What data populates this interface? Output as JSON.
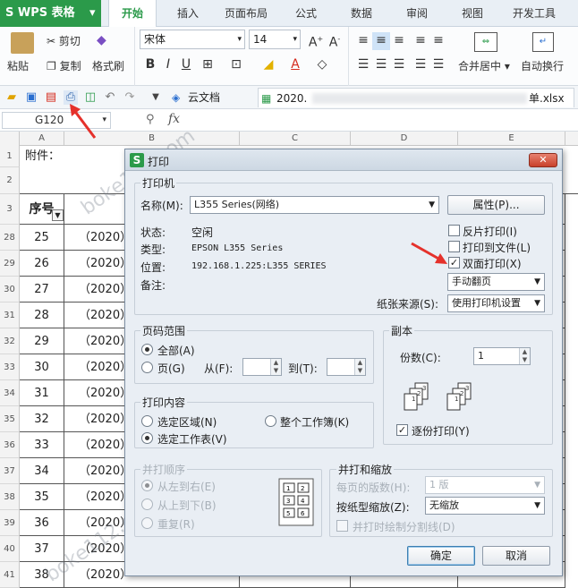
{
  "app": {
    "name": "WPS 表格"
  },
  "tabs": [
    "开始",
    "插入",
    "页面布局",
    "公式",
    "数据",
    "审阅",
    "视图",
    "开发工具"
  ],
  "ribbon": {
    "paste": "粘贴",
    "cut": "剪切",
    "copy": "复制",
    "format_painter": "格式刷",
    "font_name": "宋体",
    "font_size": "14",
    "merge_center": "合并居中",
    "wrap_text": "自动换行"
  },
  "quickbar": {
    "cloud_doc": "云文档",
    "file1": "2020.",
    "file2_suffix": "单.xlsx"
  },
  "formula_bar": {
    "name_box": "G120",
    "fx": "fx"
  },
  "grid": {
    "columns": [
      "A",
      "B",
      "C",
      "D",
      "E"
    ],
    "rows": [
      {
        "num": "1",
        "a": "附件：",
        "b": ""
      },
      {
        "num": "2",
        "a": "",
        "b": ""
      },
      {
        "num": "3",
        "a": "序号",
        "b": ""
      },
      {
        "num": "28",
        "a": "25",
        "b": "（2020）"
      },
      {
        "num": "29",
        "a": "26",
        "b": "（2020）"
      },
      {
        "num": "30",
        "a": "27",
        "b": "（2020）"
      },
      {
        "num": "31",
        "a": "28",
        "b": "（2020）"
      },
      {
        "num": "32",
        "a": "29",
        "b": "（2020）"
      },
      {
        "num": "33",
        "a": "30",
        "b": "（2020）"
      },
      {
        "num": "34",
        "a": "31",
        "b": "（2020）"
      },
      {
        "num": "35",
        "a": "32",
        "b": "（2020）"
      },
      {
        "num": "36",
        "a": "33",
        "b": "（2020）"
      },
      {
        "num": "37",
        "a": "34",
        "b": "（2020）"
      },
      {
        "num": "38",
        "a": "35",
        "b": "（2020）"
      },
      {
        "num": "39",
        "a": "36",
        "b": "（2020）"
      },
      {
        "num": "40",
        "a": "37",
        "b": "（2020）"
      },
      {
        "num": "41",
        "a": "38",
        "b": "（2020）"
      }
    ]
  },
  "dialog": {
    "title": "打印",
    "printer_group": "打印机",
    "name_label": "名称(M):",
    "printer_name": "L355 Series(网络)",
    "properties_button": "属性(P)...",
    "status_label": "状态:",
    "status_value": "空闲",
    "type_label": "类型:",
    "type_value": "EPSON L355 Series",
    "location_label": "位置:",
    "location_value": "192.168.1.225:L355 SERIES",
    "comment_label": "备注:",
    "reverse_print": "反片打印(I)",
    "print_to_file": "打印到文件(L)",
    "duplex_print": "双面打印(X)",
    "duplex_mode": "手动翻页",
    "paper_source_label": "纸张来源(S):",
    "paper_source": "使用打印机设置",
    "page_range_group": "页码范围",
    "all_label": "全部(A)",
    "pages_label": "页(G)",
    "from_label": "从(F):",
    "to_label": "到(T):",
    "copies_group": "副本",
    "copies_label": "份数(C):",
    "copies_value": "1",
    "collate_label": "逐份打印(Y)",
    "print_content_group": "打印内容",
    "selection_label": "选定区域(N)",
    "whole_workbook_label": "整个工作簿(K)",
    "selected_sheets_label": "选定工作表(V)",
    "order_group": "并打顺序",
    "left_to_right": "从左到右(E)",
    "top_to_bottom": "从上到下(B)",
    "repeat_label": "重复(R)",
    "zoom_group": "并打和缩放",
    "pages_per_sheet_label": "每页的版数(H):",
    "pages_per_sheet": "1 版",
    "scale_label": "按纸型缩放(Z):",
    "scale_value": "无缩放",
    "draw_separator": "并打时绘制分割线(D)",
    "ok_button": "确定",
    "cancel_button": "取消"
  },
  "watermark": "boke112.com",
  "colors": {
    "wps_green": "#2b9a4a",
    "arrow_red": "#e5312b"
  }
}
